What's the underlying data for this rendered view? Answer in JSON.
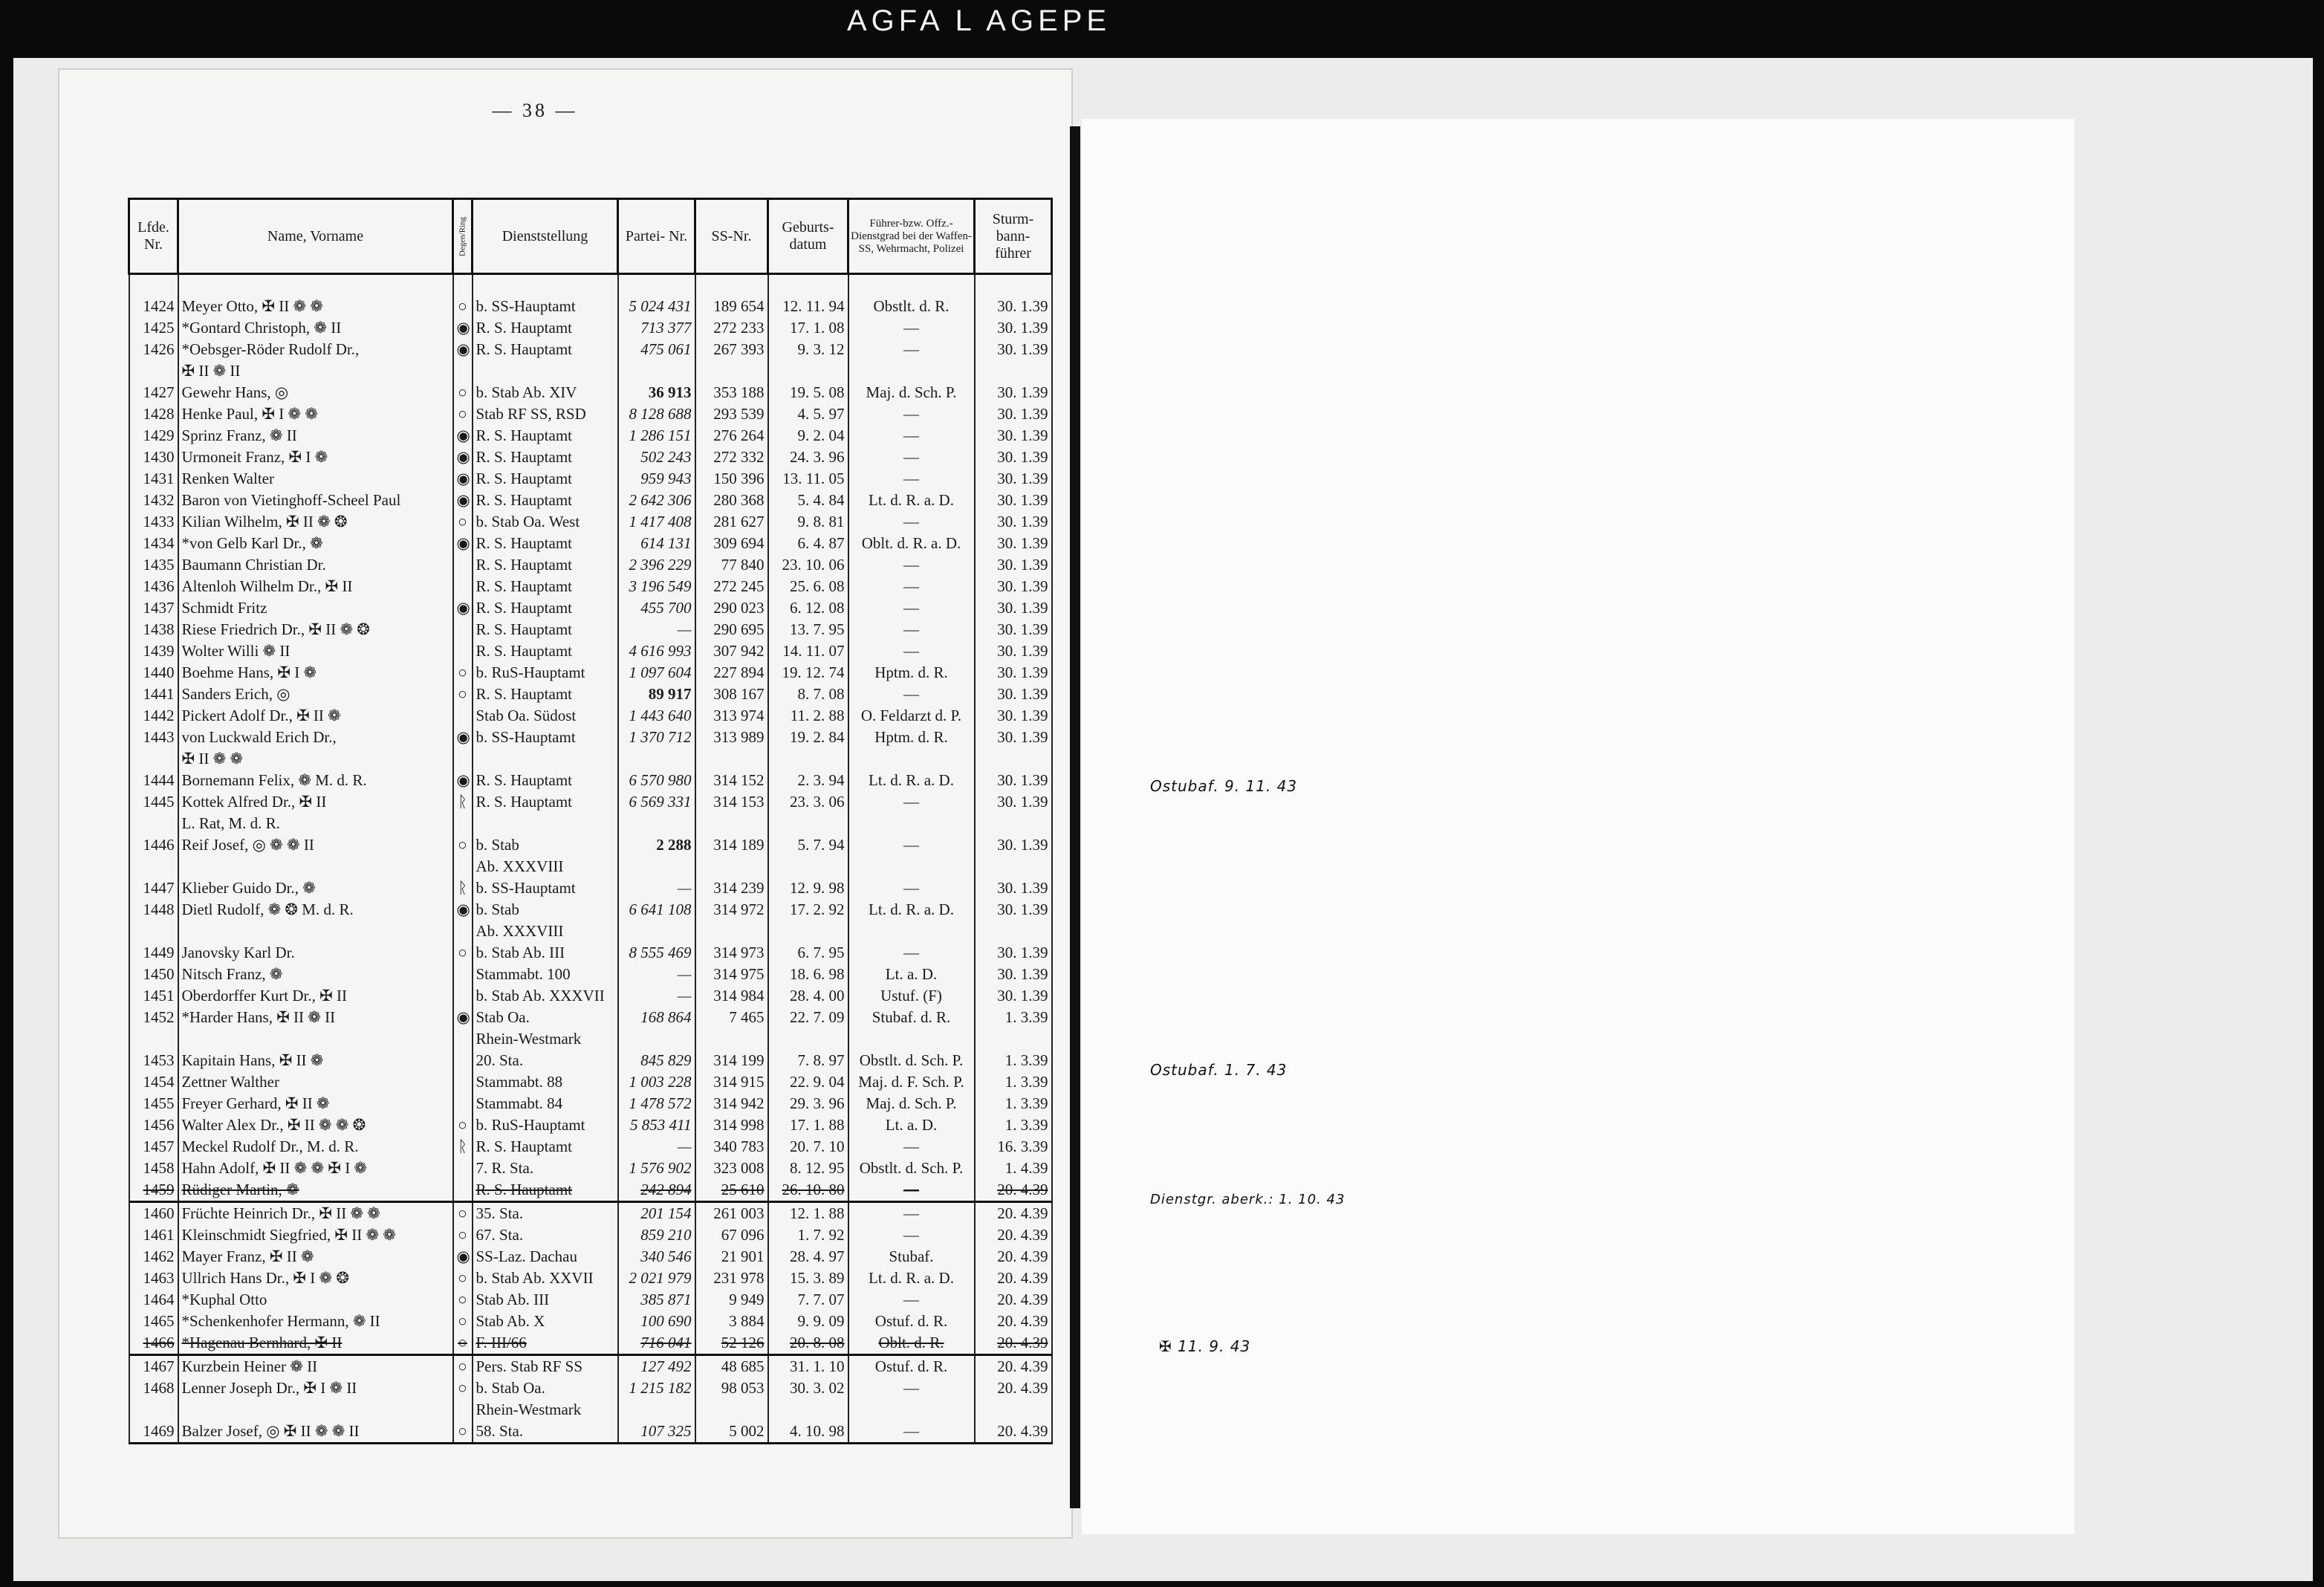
{
  "film_label": "AGFA L AGEPE",
  "page_number": "— 38 —",
  "headers": {
    "lfd": "Lfde. Nr.",
    "name": "Name, Vorname",
    "degen": "Degen/Ring",
    "dienst": "Dienststellung",
    "partei": "Partei- Nr.",
    "ss": "SS-Nr.",
    "geb": "Geburts- datum",
    "fuehrer": "Führer-bzw. Offz.- Dienstgrad bei der Waffen-SS, Wehrmacht, Polizei",
    "sturm": "Sturm- bann- führer"
  },
  "rows": [
    {
      "nr": "1424",
      "name": "Meyer Otto, ✠ II ❁ ❁",
      "sym": "○",
      "dienst": "b. SS-Hauptamt",
      "partei": "5 024 431",
      "ss": "189 654",
      "geb": "12. 11. 94",
      "rang": "Obstlt. d. R.",
      "sturm": "30.  1.39"
    },
    {
      "nr": "1425",
      "name": "*Gontard Christoph, ❁ II",
      "sym": "◉",
      "dienst": "R. S. Hauptamt",
      "partei": "713 377",
      "ss": "272 233",
      "geb": "17.  1. 08",
      "rang": "—",
      "sturm": "30.  1.39"
    },
    {
      "nr": "1426",
      "name": "*Oebsger-Röder Rudolf Dr.,",
      "sym": "◉",
      "dienst": "R. S. Hauptamt",
      "partei": "475 061",
      "ss": "267 393",
      "geb": "9.  3. 12",
      "rang": "—",
      "sturm": "30.  1.39"
    },
    {
      "nr": "",
      "name": "✠ II ❁ II",
      "sym": "",
      "dienst": "",
      "partei": "",
      "ss": "",
      "geb": "",
      "rang": "",
      "sturm": ""
    },
    {
      "nr": "1427",
      "name": "Gewehr Hans, ◎",
      "sym": "○",
      "dienst": "b. Stab Ab. XIV",
      "partei": "36 913",
      "ss": "353 188",
      "geb": "19.  5. 08",
      "rang": "Maj. d. Sch. P.",
      "sturm": "30.  1.39"
    },
    {
      "nr": "1428",
      "name": "Henke Paul, ✠ I ❁ ❁",
      "sym": "○",
      "dienst": "Stab RF SS, RSD",
      "partei": "8 128 688",
      "ss": "293 539",
      "geb": "4.  5. 97",
      "rang": "—",
      "sturm": "30.  1.39"
    },
    {
      "nr": "1429",
      "name": "Sprinz Franz, ❁ II",
      "sym": "◉",
      "dienst": "R. S. Hauptamt",
      "partei": "1 286 151",
      "ss": "276 264",
      "geb": "9.  2. 04",
      "rang": "—",
      "sturm": "30.  1.39"
    },
    {
      "nr": "1430",
      "name": "Urmoneit Franz, ✠ I ❁",
      "sym": "◉",
      "dienst": "R. S. Hauptamt",
      "partei": "502 243",
      "ss": "272 332",
      "geb": "24.  3. 96",
      "rang": "—",
      "sturm": "30.  1.39"
    },
    {
      "nr": "1431",
      "name": "Renken Walter",
      "sym": "◉",
      "dienst": "R. S. Hauptamt",
      "partei": "959 943",
      "ss": "150 396",
      "geb": "13. 11. 05",
      "rang": "—",
      "sturm": "30.  1.39"
    },
    {
      "nr": "1432",
      "name": "Baron von Vietinghoff-Scheel Paul",
      "sym": "◉",
      "dienst": "R. S. Hauptamt",
      "partei": "2 642 306",
      "ss": "280 368",
      "geb": "5.  4. 84",
      "rang": "Lt. d. R. a. D.",
      "sturm": "30.  1.39"
    },
    {
      "nr": "1433",
      "name": "Kilian Wilhelm, ✠ II ❁ ❂",
      "sym": "○",
      "dienst": "b. Stab Oa. West",
      "partei": "1 417 408",
      "ss": "281 627",
      "geb": "9.  8. 81",
      "rang": "—",
      "sturm": "30.  1.39"
    },
    {
      "nr": "1434",
      "name": "*von Gelb Karl Dr., ❁",
      "sym": "◉",
      "dienst": "R. S. Hauptamt",
      "partei": "614 131",
      "ss": "309 694",
      "geb": "6.  4. 87",
      "rang": "Oblt. d. R. a. D.",
      "sturm": "30.  1.39"
    },
    {
      "nr": "1435",
      "name": "Baumann Christian Dr.",
      "sym": "",
      "dienst": "R. S. Hauptamt",
      "partei": "2 396 229",
      "ss": "77 840",
      "geb": "23. 10. 06",
      "rang": "—",
      "sturm": "30.  1.39"
    },
    {
      "nr": "1436",
      "name": "Altenloh Wilhelm Dr., ✠ II",
      "sym": "",
      "dienst": "R. S. Hauptamt",
      "partei": "3 196 549",
      "ss": "272 245",
      "geb": "25.  6. 08",
      "rang": "—",
      "sturm": "30.  1.39"
    },
    {
      "nr": "1437",
      "name": "Schmidt Fritz",
      "sym": "◉",
      "dienst": "R. S. Hauptamt",
      "partei": "455 700",
      "ss": "290 023",
      "geb": "6. 12. 08",
      "rang": "—",
      "sturm": "30.  1.39"
    },
    {
      "nr": "1438",
      "name": "Riese Friedrich Dr., ✠ II ❁ ❂",
      "sym": "",
      "dienst": "R. S. Hauptamt",
      "partei": "—",
      "ss": "290 695",
      "geb": "13.  7. 95",
      "rang": "—",
      "sturm": "30.  1.39"
    },
    {
      "nr": "1439",
      "name": "Wolter Willi ❁ II",
      "sym": "",
      "dienst": "R. S. Hauptamt",
      "partei": "4 616 993",
      "ss": "307 942",
      "geb": "14. 11. 07",
      "rang": "—",
      "sturm": "30.  1.39"
    },
    {
      "nr": "1440",
      "name": "Boehme Hans, ✠ I ❁",
      "sym": "○",
      "dienst": "b. RuS-Hauptamt",
      "partei": "1 097 604",
      "ss": "227 894",
      "geb": "19. 12. 74",
      "rang": "Hptm. d. R.",
      "sturm": "30.  1.39"
    },
    {
      "nr": "1441",
      "name": "Sanders Erich, ◎",
      "sym": "○",
      "dienst": "R. S. Hauptamt",
      "partei": "89 917",
      "ss": "308 167",
      "geb": "8.  7. 08",
      "rang": "—",
      "sturm": "30.  1.39"
    },
    {
      "nr": "1442",
      "name": "Pickert Adolf Dr., ✠ II ❁",
      "sym": "",
      "dienst": "Stab Oa. Südost",
      "partei": "1 443 640",
      "ss": "313 974",
      "geb": "11.  2. 88",
      "rang": "O. Feldarzt d. P.",
      "sturm": "30.  1.39"
    },
    {
      "nr": "1443",
      "name": "von Luckwald Erich Dr.,",
      "sym": "◉",
      "dienst": "b. SS-Hauptamt",
      "partei": "1 370 712",
      "ss": "313 989",
      "geb": "19.  2. 84",
      "rang": "Hptm. d. R.",
      "sturm": "30.  1.39"
    },
    {
      "nr": "",
      "name": "✠ II ❁ ❁",
      "sym": "",
      "dienst": "",
      "partei": "",
      "ss": "",
      "geb": "",
      "rang": "",
      "sturm": ""
    },
    {
      "nr": "1444",
      "name": "Bornemann Felix, ❁ M. d. R.",
      "sym": "◉",
      "dienst": "R. S. Hauptamt",
      "partei": "6 570 980",
      "ss": "314 152",
      "geb": "2.  3. 94",
      "rang": "Lt. d. R. a. D.",
      "sturm": "30.  1.39"
    },
    {
      "nr": "1445",
      "name": "Kottek Alfred Dr., ✠ II",
      "sym": "ᚱ",
      "dienst": "R. S. Hauptamt",
      "partei": "6 569 331",
      "ss": "314 153",
      "geb": "23.  3. 06",
      "rang": "—",
      "sturm": "30.  1.39"
    },
    {
      "nr": "",
      "name": "L. Rat, M. d. R.",
      "sym": "",
      "dienst": "",
      "partei": "",
      "ss": "",
      "geb": "",
      "rang": "",
      "sturm": ""
    },
    {
      "nr": "1446",
      "name": "Reif Josef, ◎ ❁ ❁ II",
      "sym": "○",
      "dienst": "b. Stab",
      "partei": "2 288",
      "ss": "314 189",
      "geb": "5.  7. 94",
      "rang": "—",
      "sturm": "30.  1.39"
    },
    {
      "nr": "",
      "name": "",
      "sym": "",
      "dienst": "Ab. XXXVIII",
      "partei": "",
      "ss": "",
      "geb": "",
      "rang": "",
      "sturm": ""
    },
    {
      "nr": "1447",
      "name": "Klieber Guido Dr., ❁",
      "sym": "ᚱ",
      "dienst": "b. SS-Hauptamt",
      "partei": "—",
      "ss": "314 239",
      "geb": "12.  9. 98",
      "rang": "—",
      "sturm": "30.  1.39"
    },
    {
      "nr": "1448",
      "name": "Dietl Rudolf, ❁ ❂ M. d. R.",
      "sym": "◉",
      "dienst": "b. Stab",
      "partei": "6 641 108",
      "ss": "314 972",
      "geb": "17.  2. 92",
      "rang": "Lt. d. R. a. D.",
      "sturm": "30.  1.39"
    },
    {
      "nr": "",
      "name": "",
      "sym": "",
      "dienst": "Ab. XXXVIII",
      "partei": "",
      "ss": "",
      "geb": "",
      "rang": "",
      "sturm": ""
    },
    {
      "nr": "1449",
      "name": "Janovsky Karl Dr.",
      "sym": "○",
      "dienst": "b. Stab Ab. III",
      "partei": "8 555 469",
      "ss": "314 973",
      "geb": "6.  7. 95",
      "rang": "—",
      "sturm": "30.  1.39"
    },
    {
      "nr": "1450",
      "name": "Nitsch Franz, ❁",
      "sym": "",
      "dienst": "Stammabt. 100",
      "partei": "—",
      "ss": "314 975",
      "geb": "18.  6. 98",
      "rang": "Lt. a. D.",
      "sturm": "30.  1.39"
    },
    {
      "nr": "1451",
      "name": "Oberdorffer Kurt Dr., ✠ II",
      "sym": "",
      "dienst": "b. Stab Ab. XXXVII",
      "partei": "—",
      "ss": "314 984",
      "geb": "28.  4. 00",
      "rang": "Ustuf. (F)",
      "sturm": "30.  1.39"
    },
    {
      "nr": "1452",
      "name": "*Harder Hans, ✠ II ❁ II",
      "sym": "◉",
      "dienst": "Stab Oa.",
      "partei": "168 864",
      "ss": "7 465",
      "geb": "22.  7. 09",
      "rang": "Stubaf. d. R.",
      "sturm": "1.  3.39"
    },
    {
      "nr": "",
      "name": "",
      "sym": "",
      "dienst": "Rhein-Westmark",
      "partei": "",
      "ss": "",
      "geb": "",
      "rang": "",
      "sturm": ""
    },
    {
      "nr": "1453",
      "name": "Kapitain Hans, ✠ II ❁",
      "sym": "",
      "dienst": "20. Sta.",
      "partei": "845 829",
      "ss": "314 199",
      "geb": "7.  8. 97",
      "rang": "Obstlt. d. Sch. P.",
      "sturm": "1.  3.39"
    },
    {
      "nr": "1454",
      "name": "Zettner Walther",
      "sym": "",
      "dienst": "Stammabt. 88",
      "partei": "1 003 228",
      "ss": "314 915",
      "geb": "22.  9. 04",
      "rang": "Maj. d. F. Sch. P.",
      "sturm": "1.  3.39"
    },
    {
      "nr": "1455",
      "name": "Freyer Gerhard, ✠ II ❁",
      "sym": "",
      "dienst": "Stammabt. 84",
      "partei": "1 478 572",
      "ss": "314 942",
      "geb": "29.  3. 96",
      "rang": "Maj. d. Sch. P.",
      "sturm": "1.  3.39"
    },
    {
      "nr": "1456",
      "name": "Walter Alex Dr., ✠ II ❁ ❁ ❂",
      "sym": "○",
      "dienst": "b. RuS-Hauptamt",
      "partei": "5 853 411",
      "ss": "314 998",
      "geb": "17.  1. 88",
      "rang": "Lt. a. D.",
      "sturm": "1.  3.39"
    },
    {
      "nr": "1457",
      "name": "Meckel Rudolf Dr., M. d. R.",
      "sym": "ᚱ",
      "dienst": "R. S. Hauptamt",
      "partei": "—",
      "ss": "340 783",
      "geb": "20.  7. 10",
      "rang": "—",
      "sturm": "16.  3.39"
    },
    {
      "nr": "1458",
      "name": "Hahn Adolf, ✠ II ❁ ❁ ✠ I ❁",
      "sym": "",
      "dienst": "7. R. Sta.",
      "partei": "1 576 902",
      "ss": "323 008",
      "geb": "8. 12. 95",
      "rang": "Obstlt. d. Sch. P.",
      "sturm": "1.  4.39"
    },
    {
      "nr": "1459",
      "name": "Rüdiger Martin, ❁",
      "sym": "",
      "dienst": "R. S. Hauptamt",
      "partei": "242 894",
      "ss": "25 610",
      "geb": "26. 10. 80",
      "rang": "—",
      "sturm": "20.  4.39"
    },
    {
      "nr": "1460",
      "name": "Früchte Heinrich Dr., ✠ II ❁ ❁",
      "sym": "○",
      "dienst": "35. Sta.",
      "partei": "201 154",
      "ss": "261 003",
      "geb": "12.  1. 88",
      "rang": "—",
      "sturm": "20.  4.39"
    },
    {
      "nr": "1461",
      "name": "Kleinschmidt Siegfried, ✠ II ❁ ❁",
      "sym": "○",
      "dienst": "67. Sta.",
      "partei": "859 210",
      "ss": "67 096",
      "geb": "1.  7. 92",
      "rang": "—",
      "sturm": "20.  4.39"
    },
    {
      "nr": "1462",
      "name": "Mayer Franz, ✠ II ❁",
      "sym": "◉",
      "dienst": "SS-Laz. Dachau",
      "partei": "340 546",
      "ss": "21 901",
      "geb": "28.  4. 97",
      "rang": "Stubaf.",
      "sturm": "20.  4.39"
    },
    {
      "nr": "1463",
      "name": "Ullrich Hans Dr., ✠ I ❁ ❂",
      "sym": "○",
      "dienst": "b. Stab Ab. XXVII",
      "partei": "2 021 979",
      "ss": "231 978",
      "geb": "15.  3. 89",
      "rang": "Lt. d. R. a. D.",
      "sturm": "20.  4.39"
    },
    {
      "nr": "1464",
      "name": "*Kuphal Otto",
      "sym": "○",
      "dienst": "Stab Ab. III",
      "partei": "385 871",
      "ss": "9 949",
      "geb": "7.  7. 07",
      "rang": "—",
      "sturm": "20.  4.39"
    },
    {
      "nr": "1465",
      "name": "*Schenkenhofer Hermann, ❁ II",
      "sym": "○",
      "dienst": "Stab Ab. X",
      "partei": "100 690",
      "ss": "3 884",
      "geb": "9.  9. 09",
      "rang": "Ostuf. d. R.",
      "sturm": "20.  4.39"
    },
    {
      "nr": "1466",
      "name": "*Hagenau Bernhard, ✠ II",
      "sym": "○",
      "dienst": "F. III/66",
      "partei": "716 041",
      "ss": "52 126",
      "geb": "20.  8. 08",
      "rang": "Oblt. d. R.",
      "sturm": "20.  4.39"
    },
    {
      "nr": "1467",
      "name": "Kurzbein Heiner ❁ II",
      "sym": "○",
      "dienst": "Pers. Stab RF SS",
      "partei": "127 492",
      "ss": "48 685",
      "geb": "31.  1. 10",
      "rang": "Ostuf. d. R.",
      "sturm": "20.  4.39"
    },
    {
      "nr": "1468",
      "name": "Lenner Joseph Dr., ✠ I ❁ II",
      "sym": "○",
      "dienst": "b. Stab Oa.",
      "partei": "1 215 182",
      "ss": "98 053",
      "geb": "30.  3. 02",
      "rang": "—",
      "sturm": "20.  4.39"
    },
    {
      "nr": "",
      "name": "",
      "sym": "",
      "dienst": "Rhein-Westmark",
      "partei": "",
      "ss": "",
      "geb": "",
      "rang": "",
      "sturm": ""
    },
    {
      "nr": "1469",
      "name": "Balzer Josef, ◎ ✠ II ❁ ❁ II",
      "sym": "○",
      "dienst": "58. Sta.",
      "partei": "107 325",
      "ss": "5 002",
      "geb": "4. 10. 98",
      "rang": "—",
      "sturm": "20.  4.39"
    }
  ],
  "annotations": {
    "a1": "Ostubaf. 9. 11. 43",
    "a2": "Ostubaf. 1. 7. 43",
    "a3": "Dienstgr. aberk.: 1. 10. 43",
    "a4": "✠ 11. 9. 43"
  }
}
